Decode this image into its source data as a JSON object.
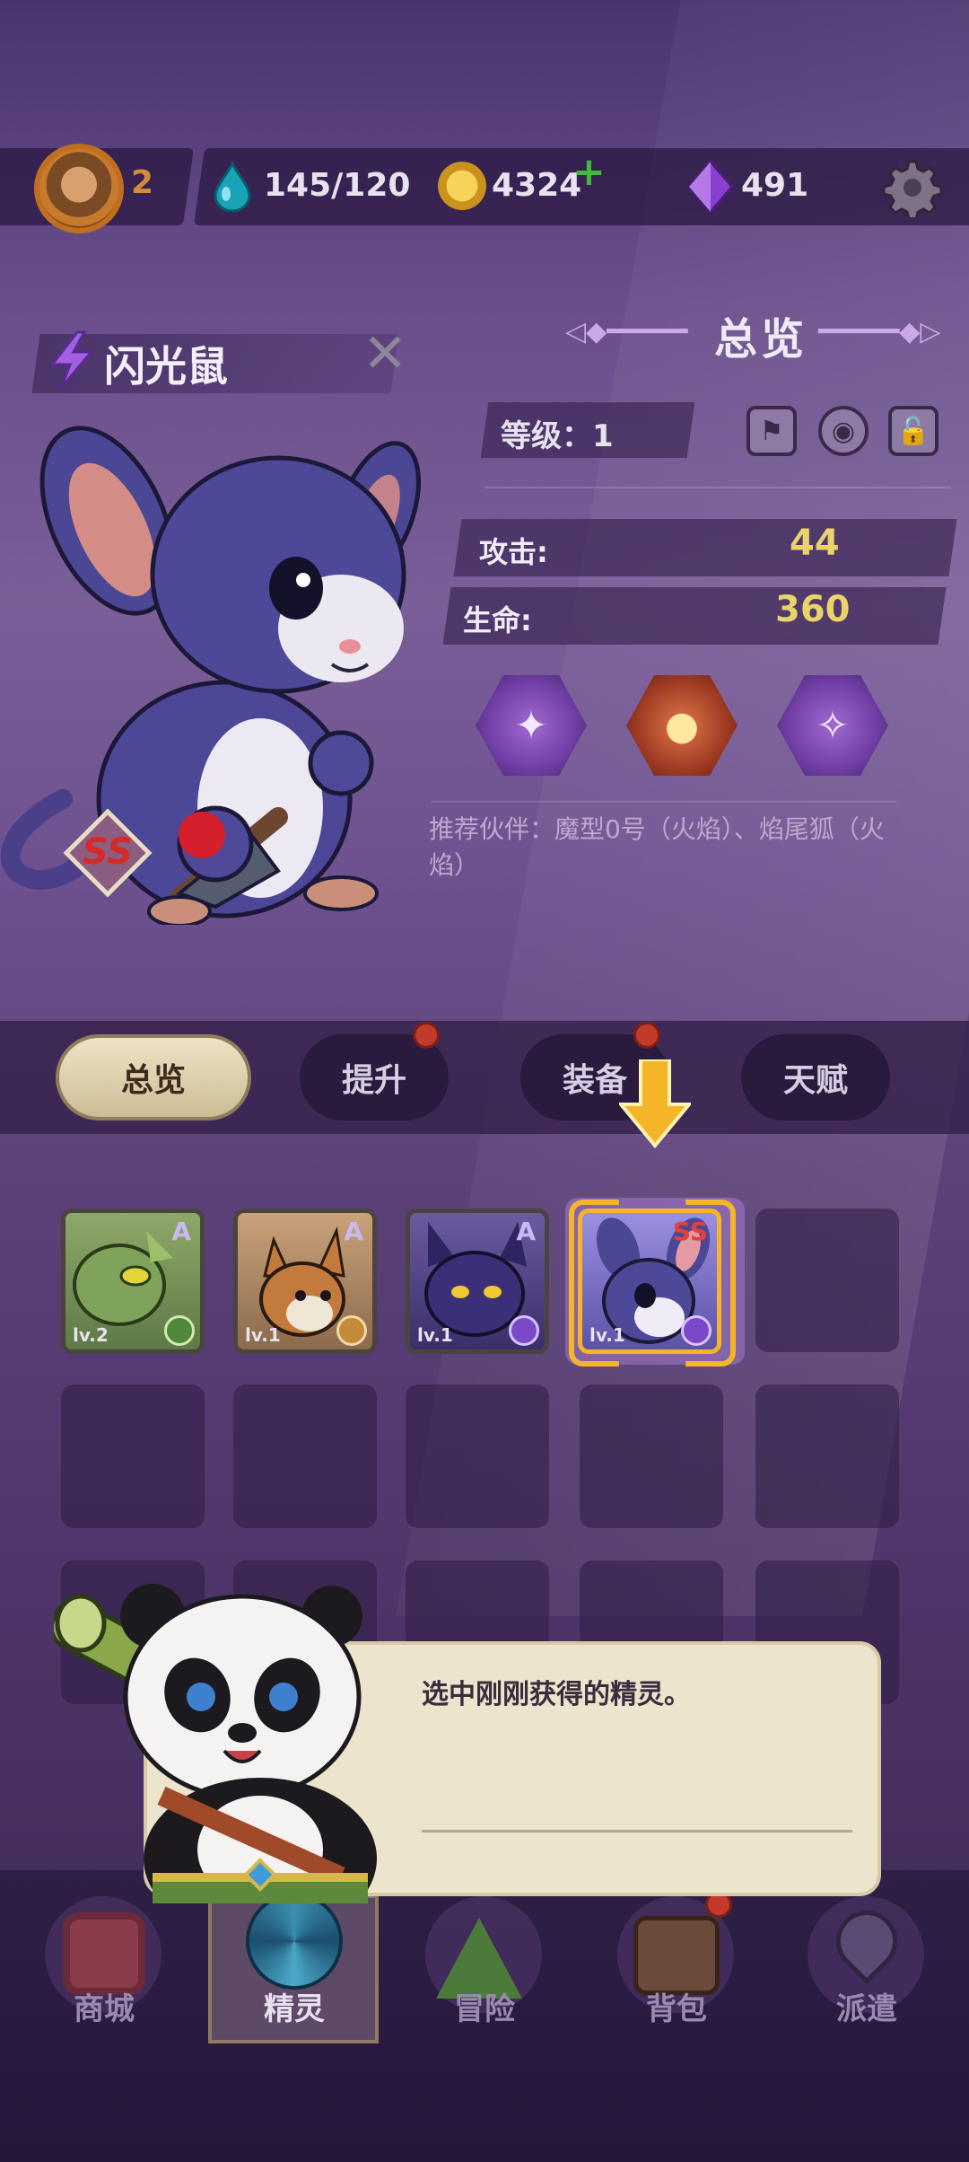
{
  "top_bar": {
    "player_level": "2",
    "energy": "145/120",
    "gold": "4324",
    "gems": "491"
  },
  "creature": {
    "name": "闪光鼠",
    "rarity": "SS"
  },
  "overview": {
    "title": "总览",
    "level_label": "等级：1",
    "attack_label": "攻击:",
    "attack_value": "44",
    "hp_label": "生命:",
    "hp_value": "360",
    "recommend_text": "推荐伙伴：魔型0号（火焰）、焰尾狐（火焰）"
  },
  "tabs": [
    {
      "label": "总览",
      "active": true,
      "badge": false
    },
    {
      "label": "提升",
      "active": false,
      "badge": true
    },
    {
      "label": "装备",
      "active": false,
      "badge": true
    },
    {
      "label": "天赋",
      "active": false,
      "badge": false
    }
  ],
  "roster": [
    {
      "rank": "A",
      "level": "lv.2",
      "element": "leaf-icon",
      "color": "#7fa35a"
    },
    {
      "rank": "A",
      "level": "lv.1",
      "element": "rock-icon",
      "color": "#b98b5c"
    },
    {
      "rank": "A",
      "level": "lv.1",
      "element": "lightning-icon",
      "color": "#4e3a86"
    },
    {
      "rank": "SS",
      "level": "lv.1",
      "element": "lightning-icon",
      "color": "#7a70c9"
    }
  ],
  "dialog": {
    "text": "选中刚刚获得的精灵。"
  },
  "nav": [
    {
      "label": "商城",
      "icon": "shop-icon"
    },
    {
      "label": "精灵",
      "icon": "spirit-icon",
      "active": true
    },
    {
      "label": "冒险",
      "icon": "adventure-icon"
    },
    {
      "label": "背包",
      "icon": "backpack-icon",
      "badge": true
    },
    {
      "label": "派遣",
      "icon": "dispatch-icon"
    }
  ],
  "colors": {
    "accent_gold": "#ead36a",
    "badge_red": "#c13a2a",
    "highlight_yellow": "#f5b528"
  }
}
